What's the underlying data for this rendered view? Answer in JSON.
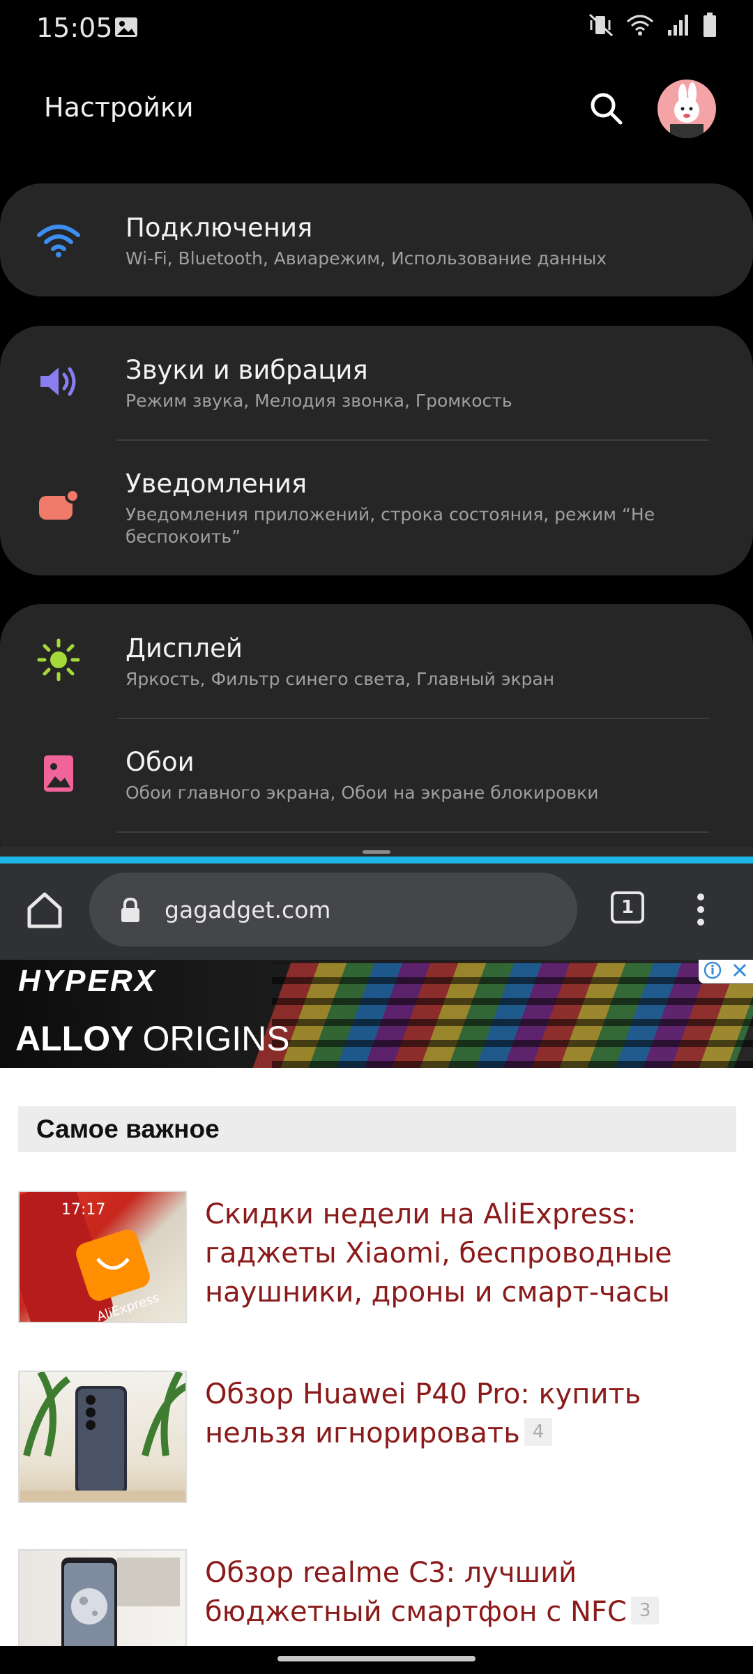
{
  "status_bar": {
    "time": "15:05"
  },
  "settings": {
    "title": "Настройки",
    "cards": [
      {
        "items": [
          {
            "icon": "wifi-icon",
            "title": "Подключения",
            "subtitle": "Wi-Fi, Bluetooth, Авиарежим, Использование данных"
          }
        ]
      },
      {
        "items": [
          {
            "icon": "volume-icon",
            "title": "Звуки и вибрация",
            "subtitle": "Режим звука, Мелодия звонка, Громкость"
          },
          {
            "icon": "notification-icon",
            "title": "Уведомления",
            "subtitle": "Уведомления приложений, строка состояния, режим “Не беспокоить”"
          }
        ]
      },
      {
        "items": [
          {
            "icon": "brightness-icon",
            "title": "Дисплей",
            "subtitle": "Яркость, Фильтр синего света, Главный экран"
          },
          {
            "icon": "wallpaper-icon",
            "title": "Обои",
            "subtitle": "Обои главного экрана, Обои на экране блокировки"
          }
        ]
      }
    ]
  },
  "browser": {
    "url": "gagadget.com",
    "tab_count": "1"
  },
  "web": {
    "ad": {
      "brand": "HYPERX",
      "product_bold": "ALLOY",
      "product_thin": "ORIGINS"
    },
    "section_title": "Самое важное",
    "articles": [
      {
        "title": "Скидки недели на AliExpress: гаджеты Xiaomi, беспроводные наушники, дроны и смарт-часы",
        "comments": ""
      },
      {
        "title": "Обзор Huawei P40 Pro: купить нельзя игнорировать",
        "comments": "4"
      },
      {
        "title": "Обзор realme C3: лучший бюджетный смартфон с NFC",
        "comments": "3"
      }
    ],
    "thumb_text": {
      "time": "17:17",
      "brand": "AliExpress"
    }
  },
  "colors": {
    "accent_split": "#1fb6e8",
    "article_link": "#8b1a1a",
    "wifi": "#3d8ef0",
    "volume": "#8a7df0",
    "notification": "#f07a6a",
    "display": "#a6d93a",
    "wallpaper": "#f0649a"
  }
}
